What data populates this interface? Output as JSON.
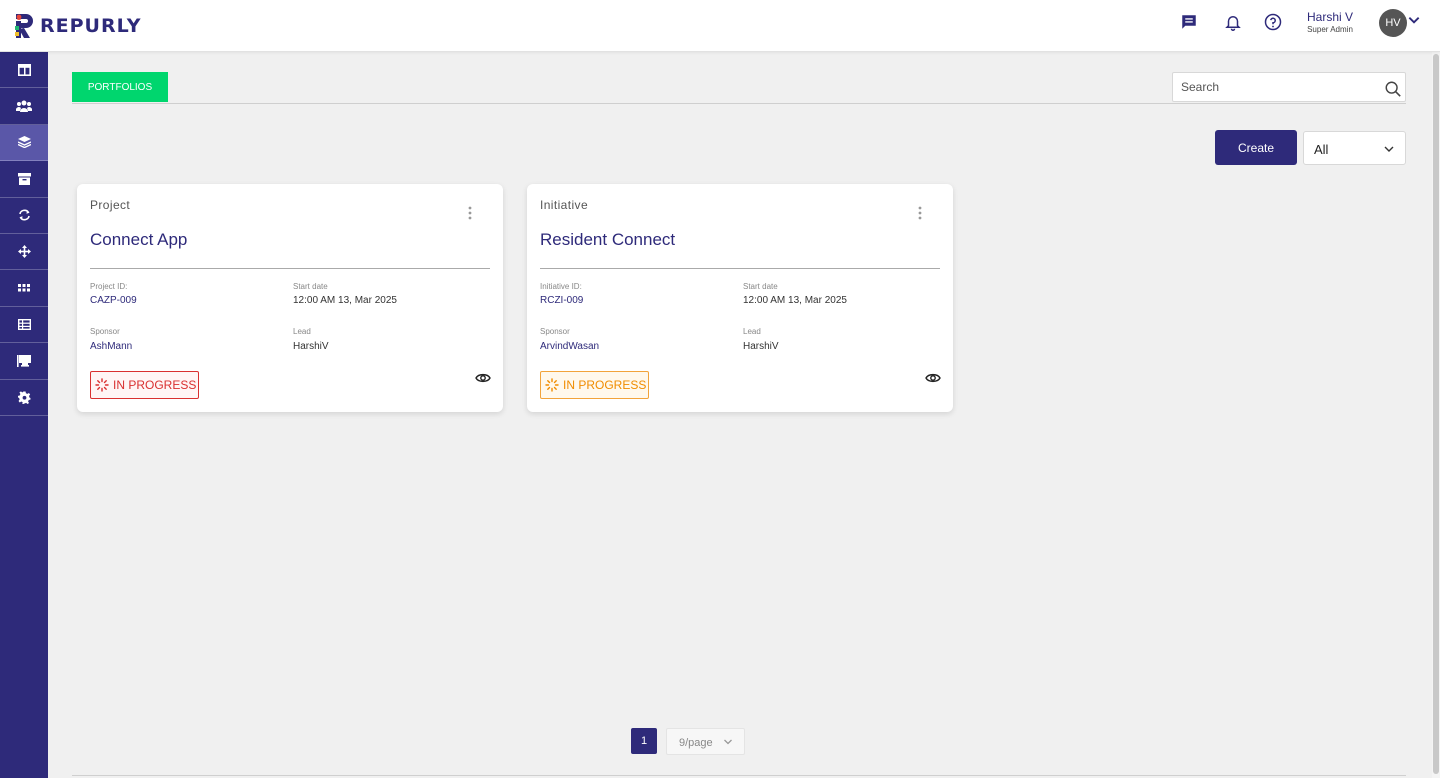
{
  "app": {
    "brand": "REPURLY"
  },
  "header": {
    "user": {
      "name": "Harshi V",
      "role": "Super Admin",
      "initials": "HV"
    }
  },
  "sidebar": {
    "items": [
      {
        "icon": "dashboard-icon"
      },
      {
        "icon": "users-icon"
      },
      {
        "icon": "layers-icon",
        "active": true
      },
      {
        "icon": "archive-icon"
      },
      {
        "icon": "sync-icon"
      },
      {
        "icon": "move-icon"
      },
      {
        "icon": "grid-icon"
      },
      {
        "icon": "table-icon"
      },
      {
        "icon": "board-icon"
      },
      {
        "icon": "settings-icon"
      }
    ]
  },
  "main": {
    "tab": "PORTFOLIOS",
    "search": {
      "placeholder": "Search",
      "value": ""
    },
    "create_label": "Create",
    "filter": {
      "selected": "All"
    },
    "cards": [
      {
        "type": "Project",
        "title": "Connect App",
        "id_label": "Project ID:",
        "id_value": "CAZP-009",
        "start_label": "Start date",
        "start_value": "12:00 AM 13, Mar 2025",
        "sponsor_label": "Sponsor",
        "sponsor_value": "AshMann",
        "lead_label": "Lead",
        "lead_value": "HarshiV",
        "status": "IN PROGRESS",
        "status_color": "#d93030"
      },
      {
        "type": "Initiative",
        "title": "Resident Connect",
        "id_label": "Initiative ID:",
        "id_value": "RCZI-009",
        "start_label": "Start date",
        "start_value": "12:00 AM 13, Mar 2025",
        "sponsor_label": "Sponsor",
        "sponsor_value": "ArvindWasan",
        "lead_label": "Lead",
        "lead_value": "HarshiV",
        "status": "IN PROGRESS",
        "status_color": "#f08c00"
      }
    ]
  },
  "pagination": {
    "current_page": "1",
    "per_page": "9/page"
  },
  "colors": {
    "brand": "#2e2a7a",
    "tab_active": "#00d66e",
    "sidebar_active": "#5a57a8"
  }
}
